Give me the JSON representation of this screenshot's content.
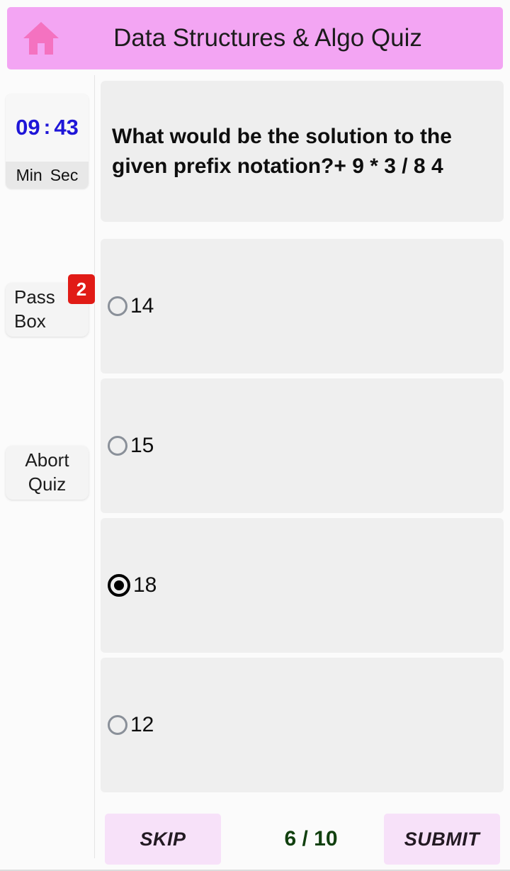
{
  "header": {
    "title": "Data Structures & Algo Quiz",
    "home_icon": "home-icon",
    "background_color": "#F3A5F3",
    "icon_color": "#F472C0"
  },
  "sidebar": {
    "timer": {
      "minutes": "09",
      "separator": ":",
      "seconds": "43",
      "min_label": "Min",
      "sec_label": "Sec",
      "digit_color": "#1F16D8"
    },
    "pass_box": {
      "line1": "Pass",
      "line2": "Box",
      "badge_count": "2",
      "badge_color": "#E11B16"
    },
    "abort": {
      "line1": "Abort",
      "line2": "Quiz"
    }
  },
  "main": {
    "question": "What would be the solution to the given prefix notation?+ 9 * 3 / 8 4",
    "options": [
      {
        "label": "14",
        "selected": false
      },
      {
        "label": "15",
        "selected": false
      },
      {
        "label": "18",
        "selected": true
      },
      {
        "label": "12",
        "selected": false
      }
    ]
  },
  "bottom_bar": {
    "skip_label": "SKIP",
    "submit_label": "SUBMIT",
    "progress": "6 / 10",
    "progress_color": "#11400F",
    "button_color": "#F7E1F9"
  }
}
